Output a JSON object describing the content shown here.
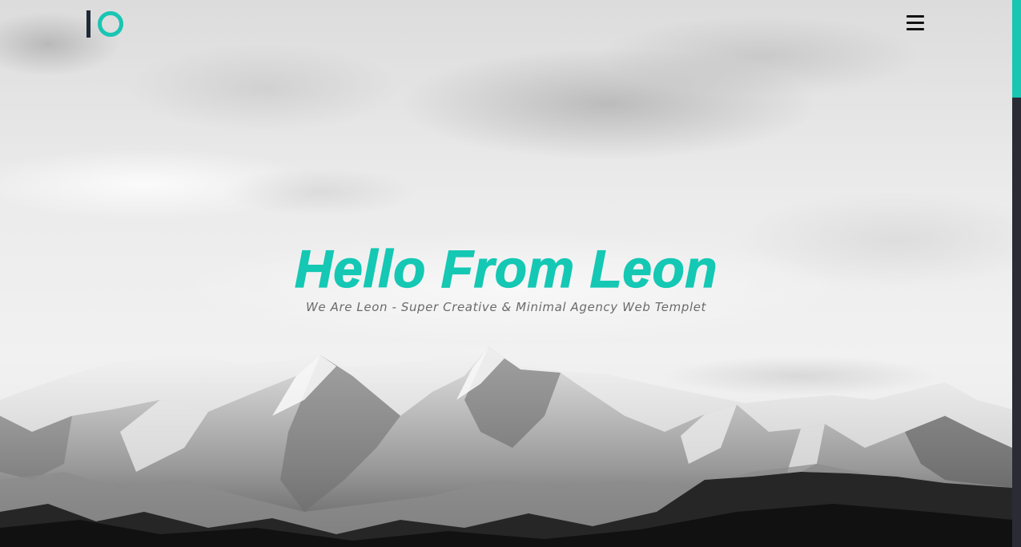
{
  "header": {
    "logo_name": "logo-icon",
    "menu_icon": "hamburger-menu-icon"
  },
  "hero": {
    "title": "Hello From Leon",
    "subtitle": "We Are Leon - Super Creative & Minimal Agency Web Templet"
  },
  "scrollbar": {
    "position_fraction": 0.0,
    "thumb_color": "#19c5b3",
    "track_color": "#2a2b35"
  },
  "colors": {
    "accent": "#14c8b4",
    "logo_dark": "#1e2a36"
  }
}
